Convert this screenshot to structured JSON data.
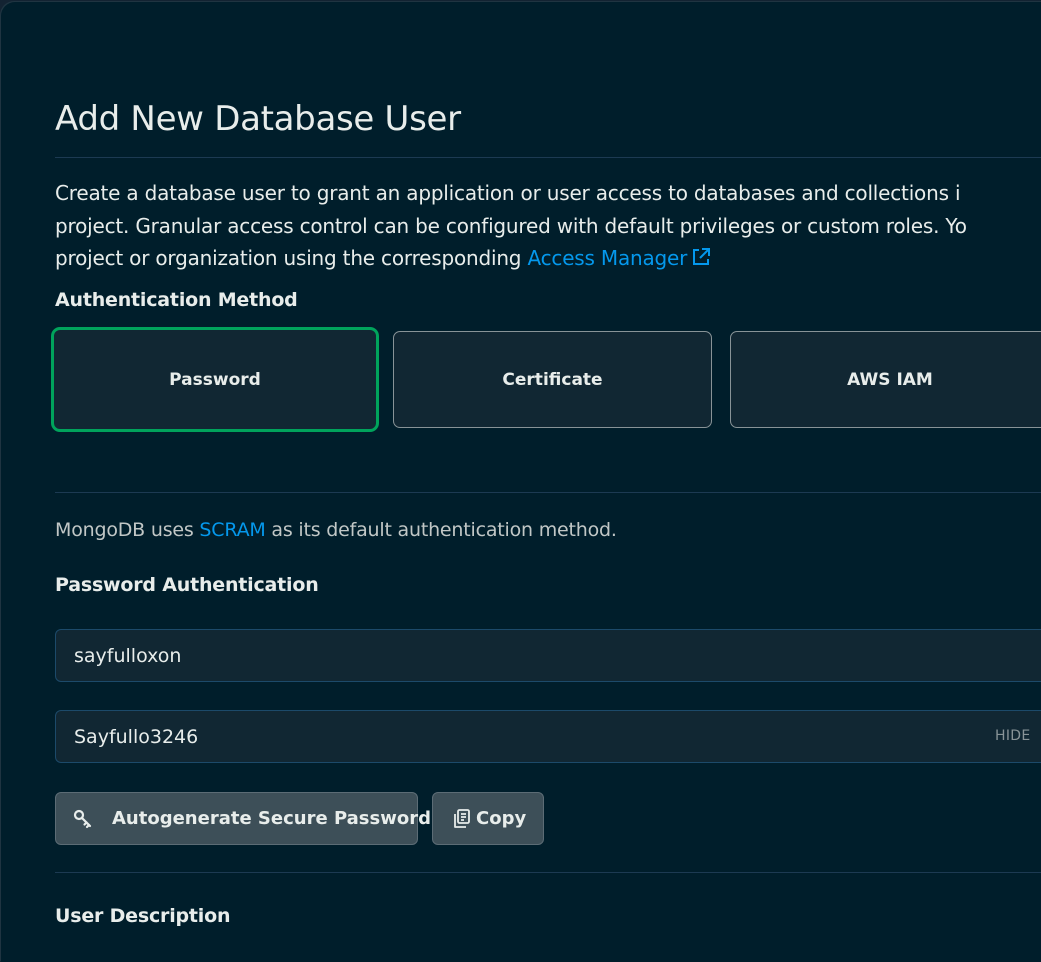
{
  "modal": {
    "title": "Add New Database User",
    "description": {
      "line1": "Create a database user to grant an application or user access to databases and collections i",
      "line2": "project. Granular access control can be configured with default privileges or custom roles. Yo",
      "line3_prefix": "project or organization using the corresponding ",
      "link": "Access Manager"
    }
  },
  "auth": {
    "label": "Authentication Method",
    "options": [
      {
        "label": "Password",
        "selected": true
      },
      {
        "label": "Certificate",
        "selected": false
      },
      {
        "label": "AWS IAM",
        "selected": false
      }
    ]
  },
  "info": {
    "prefix": "MongoDB uses ",
    "link": "SCRAM",
    "suffix": " as its default authentication method."
  },
  "password_auth": {
    "label": "Password Authentication",
    "username_value": "sayfulloxon",
    "password_value": "Sayfullo3246",
    "hide_label": "HIDE",
    "autogenerate_label": "Autogenerate Secure Password",
    "copy_label": "Copy"
  },
  "user_description": {
    "label": "User Description"
  },
  "colors": {
    "background": "#001e2b",
    "accent_green": "#00a35c",
    "link_blue": "#0498ec"
  },
  "icons": {
    "external_link": "external-link-icon",
    "key": "key-icon",
    "copy": "copy-icon"
  }
}
